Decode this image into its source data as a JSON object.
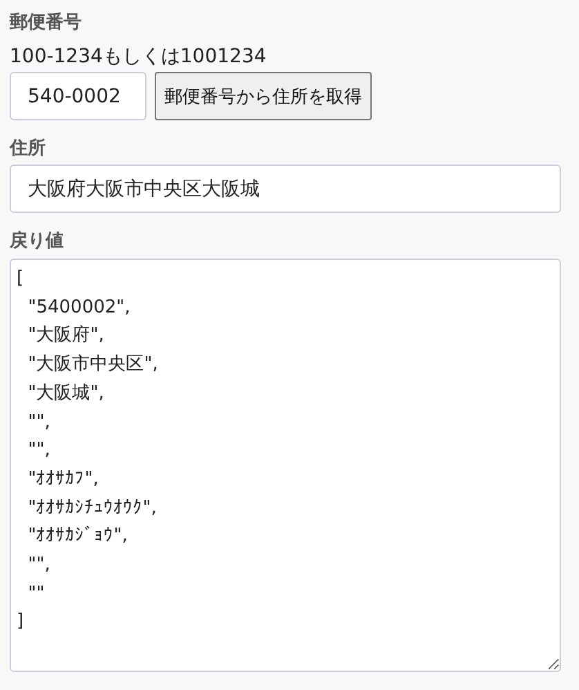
{
  "postal_label": "郵便番号",
  "postal_hint": "100-1234もしくは1001234",
  "postal_field": {
    "value": "540-0002"
  },
  "lookup_button": "郵便番号から住所を取得",
  "address_label": "住所",
  "address_field": {
    "value": "大阪府大阪市中央区大阪城"
  },
  "result_label": "戻り値",
  "result_area": {
    "value": "[\n  \"5400002\",\n  \"大阪府\",\n  \"大阪市中央区\",\n  \"大阪城\",\n  \"\",\n  \"\",\n  \"ｵｵｻｶﾌ\",\n  \"ｵｵｻｶｼﾁｭｳｵｳｸ\",\n  \"ｵｵｻｶｼﾞｮｳ\",\n  \"\",\n  \"\"\n]"
  }
}
